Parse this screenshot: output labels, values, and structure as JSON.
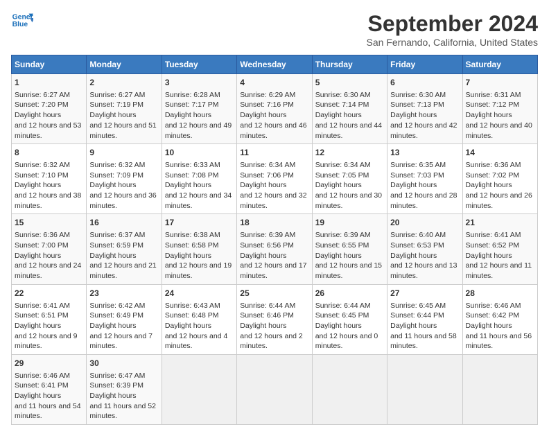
{
  "header": {
    "logo_line1": "General",
    "logo_line2": "Blue",
    "month": "September 2024",
    "location": "San Fernando, California, United States"
  },
  "days_of_week": [
    "Sunday",
    "Monday",
    "Tuesday",
    "Wednesday",
    "Thursday",
    "Friday",
    "Saturday"
  ],
  "weeks": [
    [
      {
        "day": "1",
        "sunrise": "6:27 AM",
        "sunset": "7:20 PM",
        "daylight": "12 hours and 53 minutes."
      },
      {
        "day": "2",
        "sunrise": "6:27 AM",
        "sunset": "7:19 PM",
        "daylight": "12 hours and 51 minutes."
      },
      {
        "day": "3",
        "sunrise": "6:28 AM",
        "sunset": "7:17 PM",
        "daylight": "12 hours and 49 minutes."
      },
      {
        "day": "4",
        "sunrise": "6:29 AM",
        "sunset": "7:16 PM",
        "daylight": "12 hours and 46 minutes."
      },
      {
        "day": "5",
        "sunrise": "6:30 AM",
        "sunset": "7:14 PM",
        "daylight": "12 hours and 44 minutes."
      },
      {
        "day": "6",
        "sunrise": "6:30 AM",
        "sunset": "7:13 PM",
        "daylight": "12 hours and 42 minutes."
      },
      {
        "day": "7",
        "sunrise": "6:31 AM",
        "sunset": "7:12 PM",
        "daylight": "12 hours and 40 minutes."
      }
    ],
    [
      {
        "day": "8",
        "sunrise": "6:32 AM",
        "sunset": "7:10 PM",
        "daylight": "12 hours and 38 minutes."
      },
      {
        "day": "9",
        "sunrise": "6:32 AM",
        "sunset": "7:09 PM",
        "daylight": "12 hours and 36 minutes."
      },
      {
        "day": "10",
        "sunrise": "6:33 AM",
        "sunset": "7:08 PM",
        "daylight": "12 hours and 34 minutes."
      },
      {
        "day": "11",
        "sunrise": "6:34 AM",
        "sunset": "7:06 PM",
        "daylight": "12 hours and 32 minutes."
      },
      {
        "day": "12",
        "sunrise": "6:34 AM",
        "sunset": "7:05 PM",
        "daylight": "12 hours and 30 minutes."
      },
      {
        "day": "13",
        "sunrise": "6:35 AM",
        "sunset": "7:03 PM",
        "daylight": "12 hours and 28 minutes."
      },
      {
        "day": "14",
        "sunrise": "6:36 AM",
        "sunset": "7:02 PM",
        "daylight": "12 hours and 26 minutes."
      }
    ],
    [
      {
        "day": "15",
        "sunrise": "6:36 AM",
        "sunset": "7:00 PM",
        "daylight": "12 hours and 24 minutes."
      },
      {
        "day": "16",
        "sunrise": "6:37 AM",
        "sunset": "6:59 PM",
        "daylight": "12 hours and 21 minutes."
      },
      {
        "day": "17",
        "sunrise": "6:38 AM",
        "sunset": "6:58 PM",
        "daylight": "12 hours and 19 minutes."
      },
      {
        "day": "18",
        "sunrise": "6:39 AM",
        "sunset": "6:56 PM",
        "daylight": "12 hours and 17 minutes."
      },
      {
        "day": "19",
        "sunrise": "6:39 AM",
        "sunset": "6:55 PM",
        "daylight": "12 hours and 15 minutes."
      },
      {
        "day": "20",
        "sunrise": "6:40 AM",
        "sunset": "6:53 PM",
        "daylight": "12 hours and 13 minutes."
      },
      {
        "day": "21",
        "sunrise": "6:41 AM",
        "sunset": "6:52 PM",
        "daylight": "12 hours and 11 minutes."
      }
    ],
    [
      {
        "day": "22",
        "sunrise": "6:41 AM",
        "sunset": "6:51 PM",
        "daylight": "12 hours and 9 minutes."
      },
      {
        "day": "23",
        "sunrise": "6:42 AM",
        "sunset": "6:49 PM",
        "daylight": "12 hours and 7 minutes."
      },
      {
        "day": "24",
        "sunrise": "6:43 AM",
        "sunset": "6:48 PM",
        "daylight": "12 hours and 4 minutes."
      },
      {
        "day": "25",
        "sunrise": "6:44 AM",
        "sunset": "6:46 PM",
        "daylight": "12 hours and 2 minutes."
      },
      {
        "day": "26",
        "sunrise": "6:44 AM",
        "sunset": "6:45 PM",
        "daylight": "12 hours and 0 minutes."
      },
      {
        "day": "27",
        "sunrise": "6:45 AM",
        "sunset": "6:44 PM",
        "daylight": "11 hours and 58 minutes."
      },
      {
        "day": "28",
        "sunrise": "6:46 AM",
        "sunset": "6:42 PM",
        "daylight": "11 hours and 56 minutes."
      }
    ],
    [
      {
        "day": "29",
        "sunrise": "6:46 AM",
        "sunset": "6:41 PM",
        "daylight": "11 hours and 54 minutes."
      },
      {
        "day": "30",
        "sunrise": "6:47 AM",
        "sunset": "6:39 PM",
        "daylight": "11 hours and 52 minutes."
      },
      null,
      null,
      null,
      null,
      null
    ]
  ]
}
